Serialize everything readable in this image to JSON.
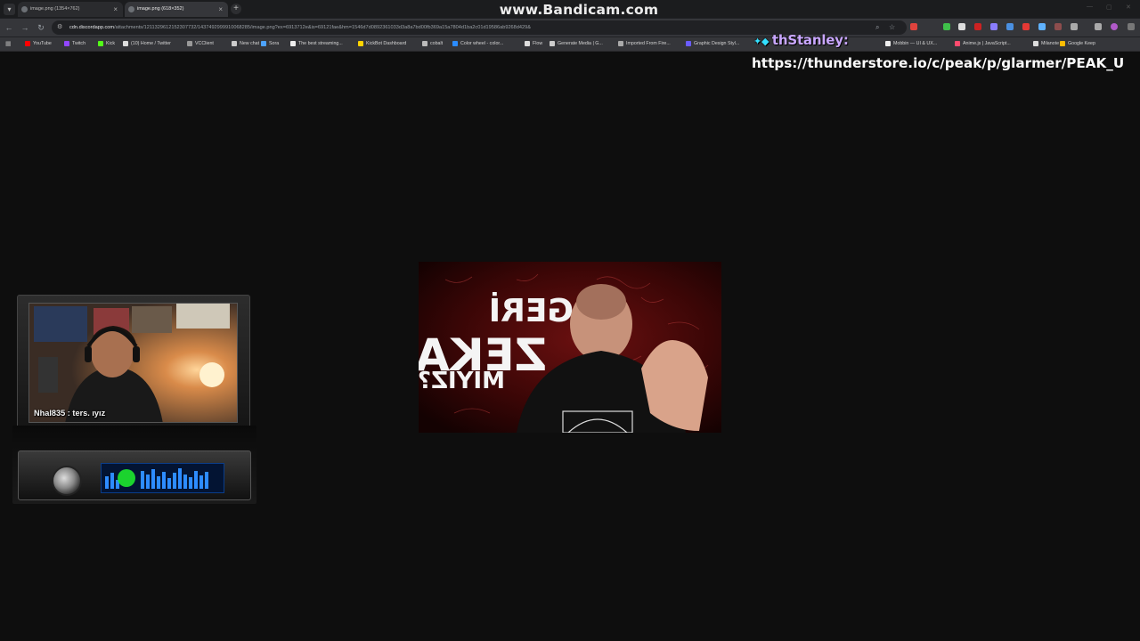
{
  "watermark": "www.Bandicam.com",
  "tabs": [
    {
      "label": "image.png (1354×762)",
      "active": false
    },
    {
      "label": "image.png (618×352)",
      "active": true
    }
  ],
  "address_bar": {
    "domain": "cdn.discordapp.com",
    "path": "/attachments/1211329612152307732/1437492999910068285/image.png?ex=6913712e&is=69121fae&hm=1546d7d0892361033d3a8a7bd00fb369a15a7804d1ba2c01d19586ab9268d429&"
  },
  "bookmarks": [
    {
      "label": "YouTube",
      "color": "#ff0000"
    },
    {
      "label": "Twitch",
      "color": "#9146ff"
    },
    {
      "label": "Kick",
      "color": "#53fc18"
    },
    {
      "label": "(10) Home / Twitter",
      "color": "#dddddd"
    },
    {
      "label": "VCClient",
      "color": "#999999"
    },
    {
      "label": "New chat",
      "color": "#cccccc"
    },
    {
      "label": "Sora",
      "color": "#4da3ff"
    },
    {
      "label": "The best streaming...",
      "color": "#eeeeee"
    },
    {
      "label": "KickBot Dashboard",
      "color": "#ffd400"
    },
    {
      "label": "cobalt",
      "color": "#bbbbbb"
    },
    {
      "label": "Color wheel - color...",
      "color": "#2b8cff"
    },
    {
      "label": "Flow",
      "color": "#dddddd"
    },
    {
      "label": "Generate Media | G...",
      "color": "#cccccc"
    },
    {
      "label": "Imported From Fire...",
      "color": "#aaaaaa"
    },
    {
      "label": "Graphic Design Styl...",
      "color": "#6a5cff"
    },
    {
      "label": "Mobbin — UI & UX...",
      "color": "#eeeeee"
    },
    {
      "label": "Anime.js | JavaScript...",
      "color": "#ff4b6e"
    },
    {
      "label": "Milanote",
      "color": "#dddddd"
    },
    {
      "label": "Google Keep",
      "color": "#fbbc04"
    }
  ],
  "stream_overlay": {
    "chat_username": "thStanley:",
    "chat_message": "https://thunderstore.io/c/peak/p/glarmer/PEAK_U",
    "webcam_chat": "Nhal835 : ters. ıyız"
  },
  "viewed_image": {
    "text_line1": "GERİ",
    "text_line2": "ZEKALI",
    "text_line3": "MIYIZ?"
  },
  "colors": {
    "browser_frame": "#202124",
    "toolbar": "#35363a",
    "page_background": "#0e0e0e",
    "overlay_name": "#c9a7ff"
  }
}
